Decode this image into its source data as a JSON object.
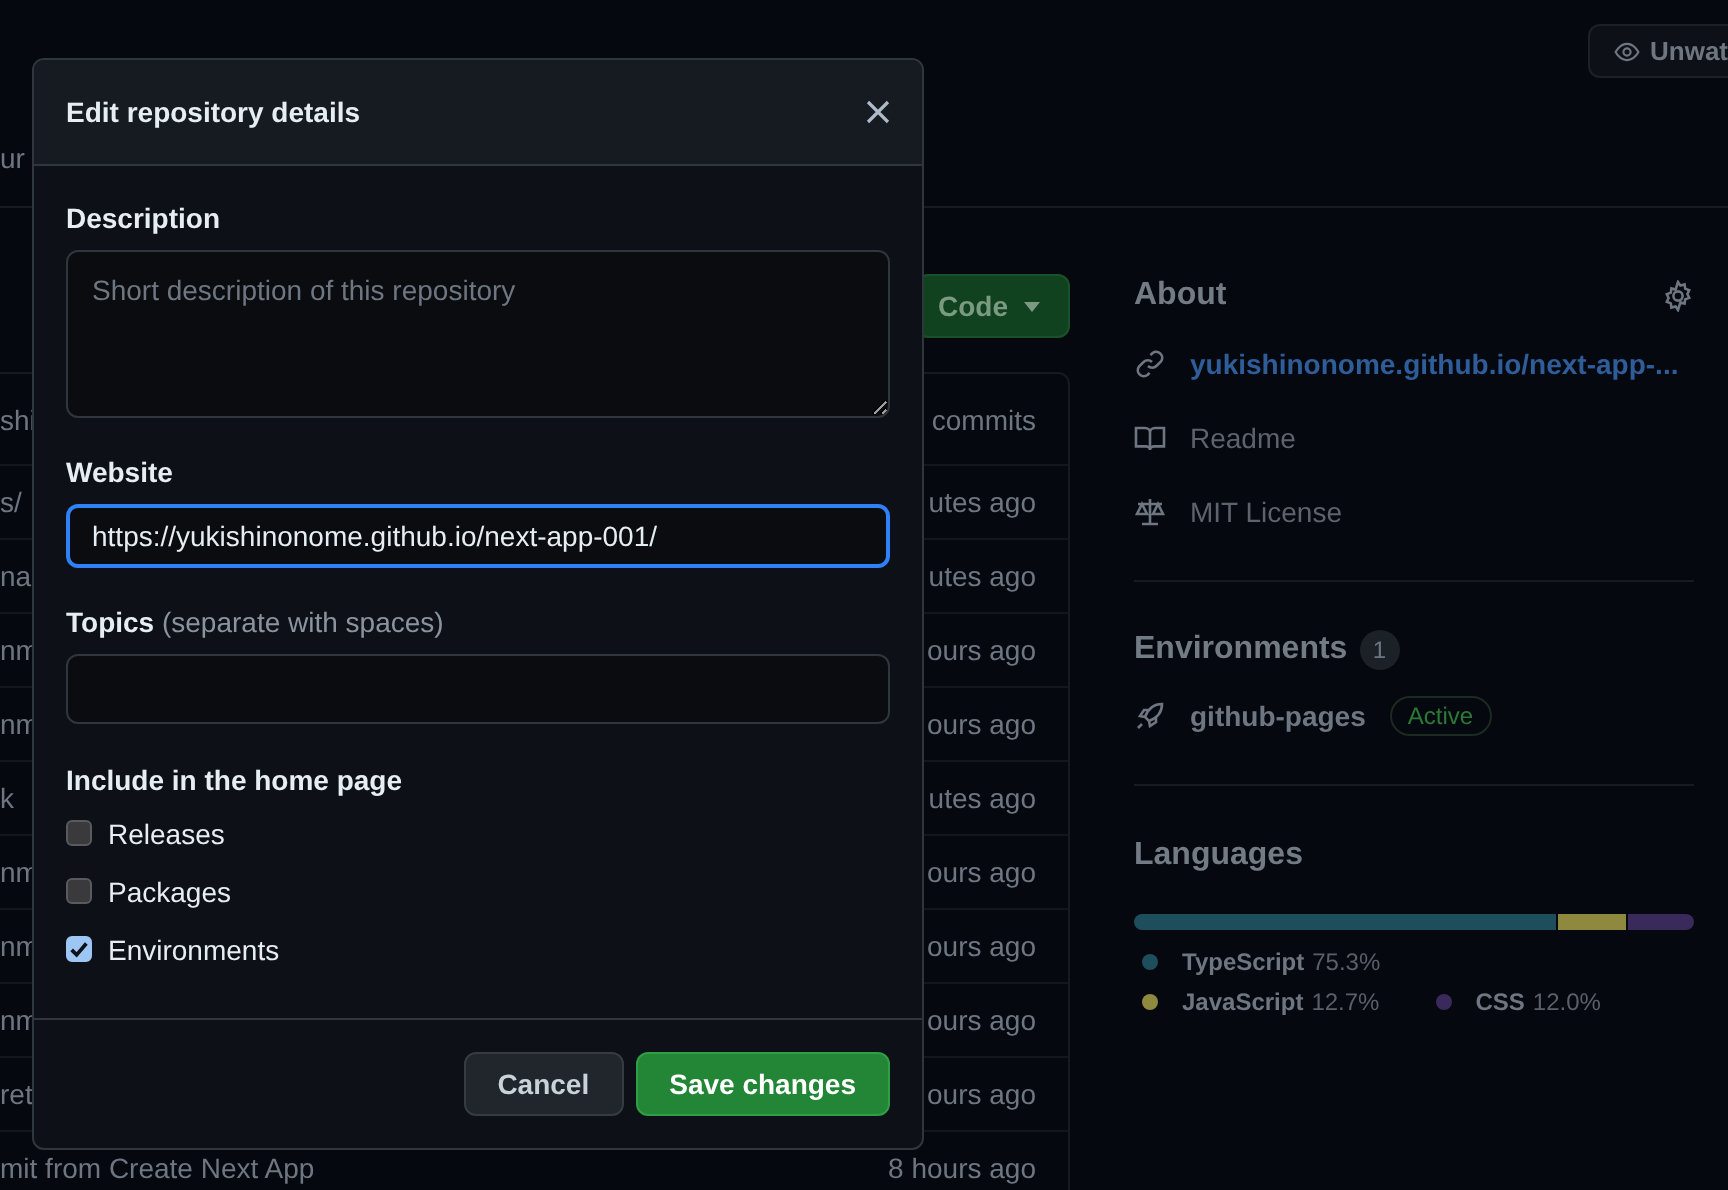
{
  "header": {
    "watch_button": "Unwat",
    "tab_fragment": "ur"
  },
  "code_button": {
    "label": "Code"
  },
  "file_list": {
    "header": {
      "left": "shi",
      "right": "commits"
    },
    "rows": [
      {
        "left": "s/",
        "right": "utes ago"
      },
      {
        "left": "na",
        "right": "utes ago"
      },
      {
        "left": "nm",
        "right": "ours ago"
      },
      {
        "left": "nm",
        "right": "ours ago"
      },
      {
        "left": "k",
        "right": "utes ago"
      },
      {
        "left": "nm",
        "right": "ours ago"
      },
      {
        "left": "nm",
        "right": "ours ago"
      },
      {
        "left": "nm",
        "right": "ours ago"
      },
      {
        "left": "ret",
        "right": "ours ago"
      },
      {
        "left": "mit from Create Next App",
        "right": "8 hours ago"
      }
    ]
  },
  "about": {
    "title": "About",
    "link": "yukishinonome.github.io/next-app-...",
    "items": [
      {
        "kind": "readme",
        "label": "Readme"
      },
      {
        "kind": "license",
        "label": "MIT License"
      }
    ]
  },
  "environments": {
    "title": "Environments",
    "count": "1",
    "items": [
      {
        "name": "github-pages",
        "status": "Active"
      }
    ]
  },
  "languages": {
    "title": "Languages",
    "items": [
      {
        "name": "TypeScript",
        "percent": "75.3%",
        "color": "#1e4d5c"
      },
      {
        "name": "JavaScript",
        "percent": "12.7%",
        "color": "#8f8940"
      },
      {
        "name": "CSS",
        "percent": "12.0%",
        "color": "#3a2a5c"
      }
    ]
  },
  "dialog": {
    "title": "Edit repository details",
    "description": {
      "label": "Description",
      "placeholder": "Short description of this repository"
    },
    "website": {
      "label": "Website",
      "value": "https://yukishinonome.github.io/next-app-001/",
      "focused": true
    },
    "topics": {
      "label": "Topics",
      "hint": "(separate with spaces)"
    },
    "include": {
      "title": "Include in the home page",
      "options": [
        {
          "label": "Releases",
          "checked": false
        },
        {
          "label": "Packages",
          "checked": false
        },
        {
          "label": "Environments",
          "checked": true
        }
      ]
    },
    "buttons": [
      {
        "kind": "secondary",
        "label": "Cancel"
      },
      {
        "kind": "primary",
        "label": "Save changes"
      }
    ]
  }
}
